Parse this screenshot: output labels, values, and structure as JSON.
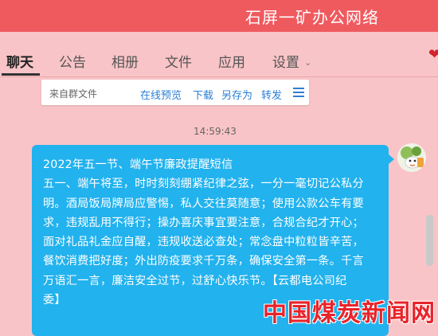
{
  "window": {
    "title": "石屏一矿办公网络"
  },
  "tabs": [
    {
      "label": "聊天",
      "active": true
    },
    {
      "label": "公告"
    },
    {
      "label": "相册"
    },
    {
      "label": "文件"
    },
    {
      "label": "应用"
    },
    {
      "label": "设置"
    }
  ],
  "file_bar": {
    "label": "来自群文件",
    "actions": [
      "在线预览",
      "下载",
      "另存为",
      "转发"
    ],
    "menu_icon": "menu-icon"
  },
  "chat": {
    "timestamp": "14:59:43",
    "message_lines": [
      "2022年五一节、端午节廉政提醒短信",
      "五一、端午将至，时时刻刻绷紧纪律之弦，一分一毫切记公私分",
      "明。酒局饭局牌局应警惕，私人交往莫随意；使用公款公车有要",
      "求，违规乱用不得行；操办喜庆事宜要注意，合规合纪才开心；",
      "面对礼品礼金应自醒，违规收送必查处；常念盘中粒粒皆辛苦，",
      "餐饮消费把好度；外出防疫要求千万条，确保安全第一条。千言",
      "万语汇一言，廉洁安全过节，过舒心快乐节。【云都电公司纪",
      "委】"
    ]
  },
  "watermark": "中国煤炭新闻网",
  "colors": {
    "titlebar": "#ef5a5f",
    "background": "#f9c4c7",
    "bubble": "#22b2ee",
    "link": "#2d7fd3"
  }
}
